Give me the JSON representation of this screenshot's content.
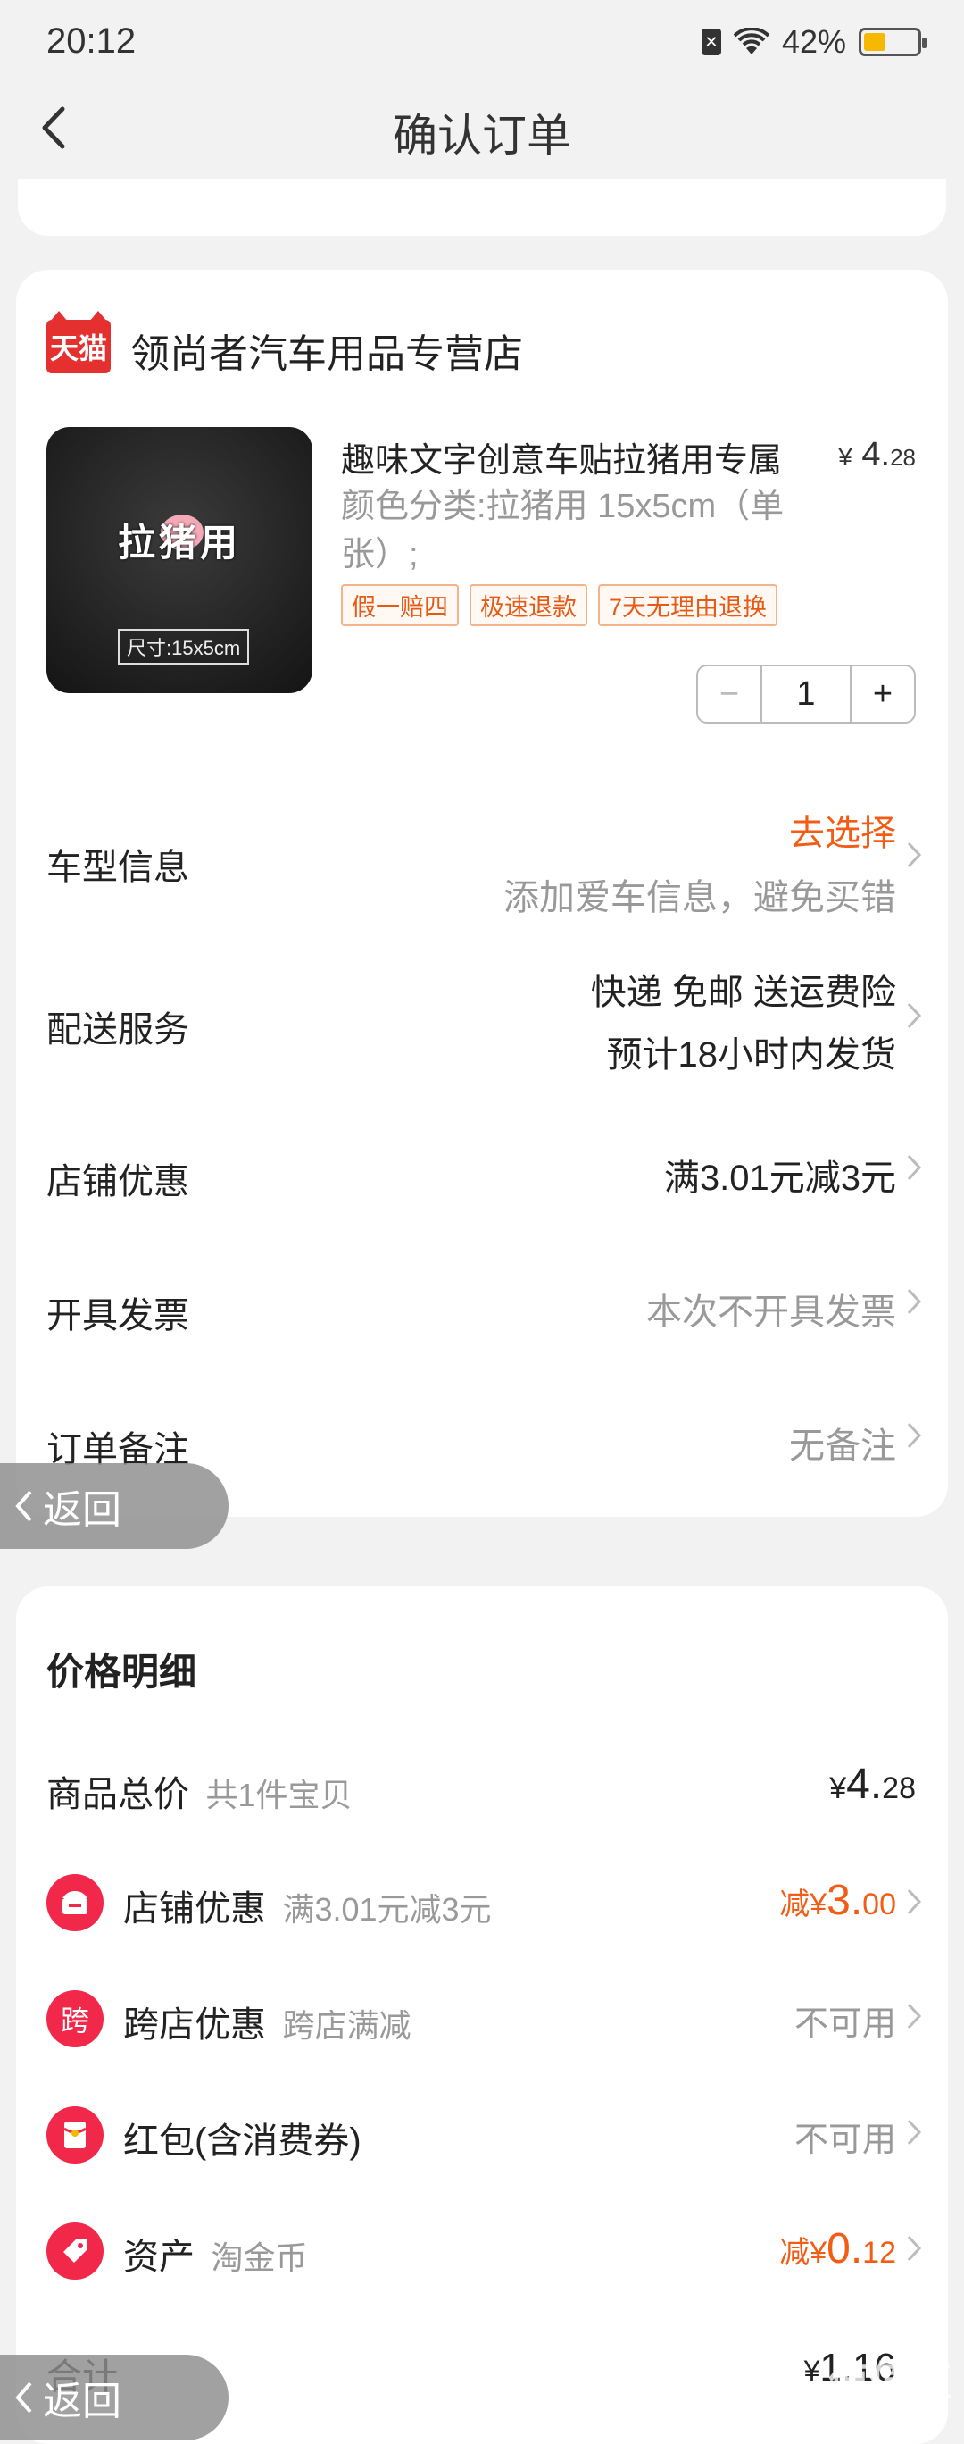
{
  "status": {
    "time": "20:12",
    "battery_pct": "42%",
    "battery_level": 0.42
  },
  "nav": {
    "title": "确认订单"
  },
  "shop": {
    "name": "领尚者汽车用品专营店",
    "badge": "天猫"
  },
  "product": {
    "title": "趣味文字创意车贴拉猪用专属",
    "price_symbol": "¥",
    "price_int": "4.",
    "price_dec": "28",
    "spec": "颜色分类:拉猪用 15x5cm（单张）;",
    "image_text": "拉猪用",
    "image_size": "尺寸:15x5cm",
    "tags": [
      "假一赔四",
      "极速退款",
      "7天无理由退换"
    ],
    "quantity": "1"
  },
  "order_rows": {
    "car": {
      "label": "车型信息",
      "value": "去选择",
      "sub": "添加爱车信息，避免买错"
    },
    "delivery": {
      "label": "配送服务",
      "value": "快递 免邮 送运费险",
      "sub": "预计18小时内发货"
    },
    "shop_discount": {
      "label": "店铺优惠",
      "value": "满3.01元减3元"
    },
    "invoice": {
      "label": "开具发票",
      "value": "本次不开具发票"
    },
    "remark": {
      "label": "订单备注",
      "value": "无备注"
    }
  },
  "float_back": {
    "label": "返回"
  },
  "price_detail": {
    "title": "价格明细",
    "goods_total": {
      "label": "商品总价",
      "sub": "共1件宝贝",
      "symbol": "¥",
      "int": "4.",
      "dec": "28"
    },
    "shop_discount": {
      "label": "店铺优惠",
      "sub": "满3.01元减3元",
      "prefix": "减",
      "symbol": "¥",
      "int": "3.",
      "dec": "00"
    },
    "cross_discount": {
      "label": "跨店优惠",
      "sub": "跨店满减",
      "value": "不可用",
      "icon_text": "跨"
    },
    "red_packet": {
      "label": "红包(含消费券)",
      "value": "不可用"
    },
    "assets": {
      "label": "资产",
      "sub": "淘金币",
      "prefix": "减",
      "symbol": "¥",
      "int": "0.",
      "dec": "12"
    },
    "total": {
      "label": "合计",
      "symbol": "¥",
      "value": "1.16"
    }
  },
  "watermark": {
    "text": "值值值",
    "url": "zhizhizhi.com"
  },
  "colors": {
    "accent": "#f25c14",
    "tmall": "#e4312f",
    "icon_red": "#f2284a"
  }
}
